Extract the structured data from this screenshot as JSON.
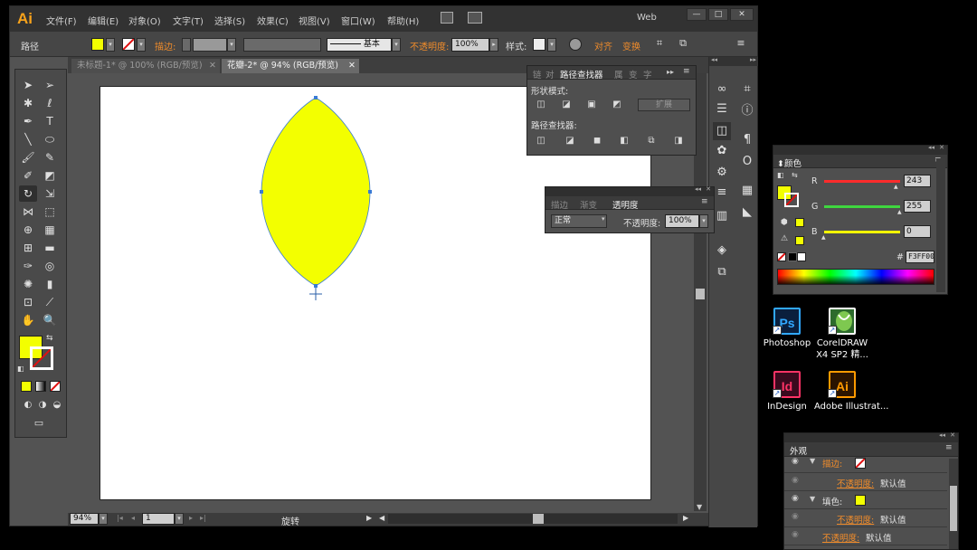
{
  "app": {
    "logo": "Ai",
    "menu": [
      "文件(F)",
      "编辑(E)",
      "对象(O)",
      "文字(T)",
      "选择(S)",
      "效果(C)",
      "视图(V)",
      "窗口(W)",
      "帮助(H)"
    ],
    "workspace": "Web",
    "win_min": "—",
    "win_max": "□",
    "win_close": "✕"
  },
  "control_bar": {
    "object_type": "路径",
    "fill_color": "#f3ff00",
    "stroke_label": "描边:",
    "stroke_style": "基本",
    "opacity_label": "不透明度:",
    "opacity_value": "100%",
    "style_label": "样式:",
    "align_label": "对齐",
    "transform_label": "变换"
  },
  "doc_tabs": [
    {
      "label": "未标题-1* @ 100% (RGB/预览)",
      "active": false
    },
    {
      "label": "花瓣-2* @ 94% (RGB/预览)",
      "active": true
    }
  ],
  "tab_close": "✕",
  "status_bar": {
    "zoom": "94%",
    "page": "1",
    "tool_name": "旋转"
  },
  "pathfinder": {
    "tabs": [
      "链",
      "对",
      "路径查找器",
      "属",
      "变",
      "字"
    ],
    "shape_modes_label": "形状模式:",
    "expand_label": "扩展",
    "pathfinders_label": "路径查找器:"
  },
  "transparency": {
    "tabs": [
      "描边",
      "渐变",
      "透明度"
    ],
    "blend_mode": "正常",
    "opacity_label": "不透明度:",
    "opacity_value": "100%"
  },
  "color_panel": {
    "title": "颜色",
    "channels": [
      {
        "label": "R",
        "value": "243",
        "fraction": 0.953,
        "color": "#ff2b2b"
      },
      {
        "label": "G",
        "value": "255",
        "fraction": 1.0,
        "color": "#3fd63f"
      },
      {
        "label": "B",
        "value": "0",
        "fraction": 0.0,
        "color": "#f3ff00"
      }
    ],
    "hash": "#",
    "hex_value": "F3FF00",
    "fill_color": "#f3ff00"
  },
  "desktop_icons": [
    {
      "label": "Photoshop",
      "glyph": "Ps",
      "bg": "#0a1f3d",
      "fg": "#31a8ff"
    },
    {
      "label": "CorelDRAW X4 SP2 精...",
      "glyph": "",
      "bg": "#2d6b2d",
      "fg": "#ffffff"
    },
    {
      "label": "InDesign",
      "glyph": "Id",
      "bg": "#3a0a1e",
      "fg": "#ff3366"
    },
    {
      "label": "Adobe Illustrat...",
      "glyph": "Ai",
      "bg": "#2b1400",
      "fg": "#ff9a00"
    }
  ],
  "appearance": {
    "title": "外观",
    "rows": [
      {
        "type": "stroke",
        "label": "描边:"
      },
      {
        "type": "opacity",
        "label": "不透明度:",
        "value": "默认值"
      },
      {
        "type": "fill",
        "label": "填色:"
      },
      {
        "type": "opacity",
        "label": "不透明度:",
        "value": "默认值"
      },
      {
        "type": "opacity",
        "label": "不透明度:",
        "value": "默认值"
      }
    ]
  }
}
